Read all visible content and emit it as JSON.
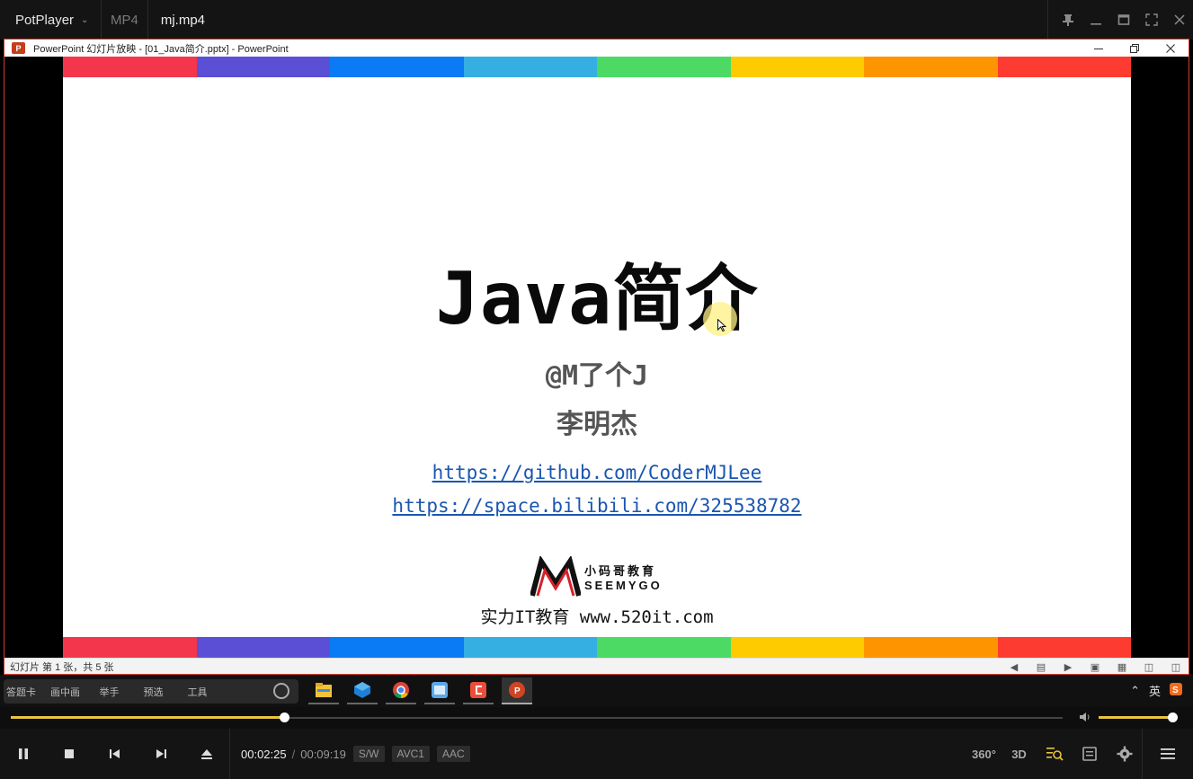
{
  "player": {
    "brand": "PotPlayer",
    "format": "MP4",
    "filename": "mj.mp4"
  },
  "ppt": {
    "window_title": "PowerPoint 幻灯片放映 - [01_Java简介.pptx] - PowerPoint",
    "status_text": "幻灯片 第 1 张，共 5 张"
  },
  "slide": {
    "title": "Java简介",
    "author": "@M了个J",
    "name": "李明杰",
    "link1": "https://github.com/CoderMJLee",
    "link2": "https://space.bilibili.com/325538782",
    "logo_cn": "小码哥教育",
    "logo_en": "SEEMYGO",
    "slogan": "实力IT教育 www.520it.com",
    "stripe_colors": [
      "#f4364c",
      "#5b4fd6",
      "#0a7af5",
      "#35aee2",
      "#4cd964",
      "#fecb00",
      "#fe9500",
      "#fe3b30"
    ]
  },
  "taskbar": {
    "items": [
      "答题卡",
      "画中画",
      "举手",
      "预选",
      "工具"
    ],
    "ime": "英"
  },
  "playback": {
    "progress_fraction": 0.26,
    "volume_fraction": 1.0,
    "time_current": "00:02:25",
    "time_total": "00:09:19",
    "badges": [
      "S/W",
      "AVC1",
      "AAC"
    ]
  },
  "right_controls": [
    "360°",
    "3D"
  ],
  "colors": {
    "accent": "#e9c53a",
    "ppt_border": "#d43b2a"
  }
}
